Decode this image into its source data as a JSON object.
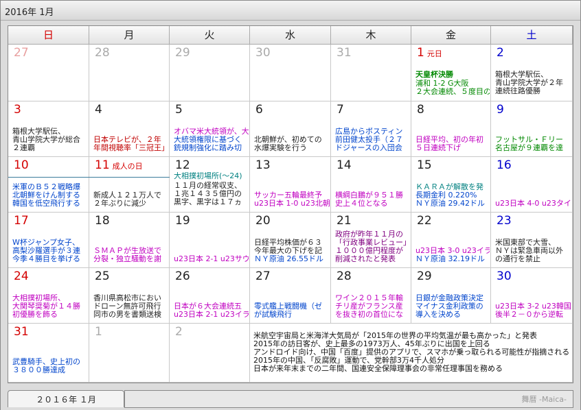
{
  "window": {
    "title": "2016年 1月"
  },
  "weekdays": [
    "日",
    "月",
    "火",
    "水",
    "木",
    "金",
    "土"
  ],
  "days": [
    {
      "n": "27",
      "style": "pinkgrey",
      "events": []
    },
    {
      "n": "28",
      "style": "grey",
      "events": []
    },
    {
      "n": "29",
      "style": "grey",
      "events": []
    },
    {
      "n": "30",
      "style": "grey",
      "events": []
    },
    {
      "n": "31",
      "style": "grey",
      "events": []
    },
    {
      "n": "1",
      "style": "sun",
      "holiday": "元日",
      "events": [
        {
          "t": "天皇杯決勝",
          "c": "c-green bold",
          "y": 38
        },
        {
          "t": "浦和 1-2 G大阪",
          "c": "c-green",
          "y": 51
        },
        {
          "t": "２大会連続、５度目の",
          "c": "c-green",
          "y": 63
        }
      ]
    },
    {
      "n": "2",
      "style": "sat",
      "events": [
        {
          "t": "箱根大学駅伝、",
          "c": "c-black",
          "y": 38
        },
        {
          "t": "青山学院大学が２年",
          "c": "c-black",
          "y": 50
        },
        {
          "t": "連続往路優勝",
          "c": "c-black",
          "y": 62
        }
      ]
    },
    {
      "n": "3",
      "style": "sun",
      "events": [
        {
          "t": "箱根大学駅伝、",
          "c": "c-black",
          "y": 38
        },
        {
          "t": "青山学院大学が総合",
          "c": "c-black",
          "y": 50
        },
        {
          "t": "２連覇",
          "c": "c-black",
          "y": 62
        }
      ]
    },
    {
      "n": "4",
      "style": "c-black",
      "events": [
        {
          "t": "日本テレビが、２年",
          "c": "c-red",
          "y": 50
        },
        {
          "t": "年間視聴率「三冠王」",
          "c": "c-red",
          "y": 62
        }
      ]
    },
    {
      "n": "5",
      "style": "c-black",
      "events": [
        {
          "t": "オバマ米大統領が、大",
          "c": "c-mag",
          "y": 38
        },
        {
          "t": "大統領権限に基づく",
          "c": "c-blue",
          "y": 50
        },
        {
          "t": "銃規制強化に踏み切",
          "c": "c-blue",
          "y": 62
        }
      ]
    },
    {
      "n": "6",
      "style": "c-black",
      "events": [
        {
          "t": "北朝鮮が、初めての",
          "c": "c-black",
          "y": 50
        },
        {
          "t": "水爆実験を行う",
          "c": "c-black",
          "y": 62
        }
      ]
    },
    {
      "n": "7",
      "style": "c-black",
      "events": [
        {
          "t": "広島からポスティン",
          "c": "c-blue",
          "y": 38
        },
        {
          "t": "前田健太投手（２７",
          "c": "c-blue",
          "y": 50
        },
        {
          "t": "ドジャースの入団会",
          "c": "c-blue",
          "y": 62
        }
      ]
    },
    {
      "n": "8",
      "style": "c-black",
      "events": [
        {
          "t": "日経平均、初の年初",
          "c": "c-mag",
          "y": 50
        },
        {
          "t": "５日連続下げ",
          "c": "c-mag",
          "y": 62
        }
      ]
    },
    {
      "n": "9",
      "style": "sat",
      "events": [
        {
          "t": "フットサル・Ｆリー",
          "c": "c-green",
          "y": 50
        },
        {
          "t": "名古屋が９連覇を達",
          "c": "c-green",
          "y": 62
        }
      ]
    },
    {
      "n": "10",
      "style": "sun",
      "events": [
        {
          "t": "米軍のＢ５２戦略爆",
          "c": "c-blue",
          "y": 38
        },
        {
          "t": "北朝鮮をけん制する",
          "c": "c-blue",
          "y": 50
        },
        {
          "t": "韓国を低空飛行する",
          "c": "c-blue",
          "y": 62
        }
      ]
    },
    {
      "n": "11",
      "style": "sun",
      "holiday": "成人の日",
      "events": [
        {
          "t": "新成人１２１万人で",
          "c": "c-black",
          "y": 50
        },
        {
          "t": "２年ぶりに減少",
          "c": "c-black",
          "y": 62
        }
      ]
    },
    {
      "n": "12",
      "style": "c-black",
      "events": [
        {
          "t": "大相撲初場所(～24)",
          "c": "c-teal",
          "y": 22
        },
        {
          "t": "１１月の経常収支、",
          "c": "c-black",
          "y": 36
        },
        {
          "t": "１兆１４３５億円の",
          "c": "c-black",
          "y": 48
        },
        {
          "t": "黒字、黒字は１７ヵ",
          "c": "c-black",
          "y": 60
        }
      ]
    },
    {
      "n": "13",
      "style": "c-black",
      "events": [
        {
          "t": "サッカー五輪最終予",
          "c": "c-mag",
          "y": 50
        },
        {
          "t": "u23日本 1-0 u23北朝",
          "c": "c-mag",
          "y": 62
        }
      ]
    },
    {
      "n": "14",
      "style": "c-black",
      "events": [
        {
          "t": "横綱白鵬が９５１勝",
          "c": "c-mag",
          "y": 50
        },
        {
          "t": "史上４位となる",
          "c": "c-mag",
          "y": 62
        }
      ]
    },
    {
      "n": "15",
      "style": "c-black",
      "events": [
        {
          "t": "ＫＡＲＡが解散を発",
          "c": "c-teal",
          "y": 38
        },
        {
          "t": "長期金利 0.220%",
          "c": "c-blue",
          "y": 50
        },
        {
          "t": "ＮＹ原油 29.42ドル",
          "c": "c-blue",
          "y": 62
        }
      ]
    },
    {
      "n": "16",
      "style": "sat",
      "events": [
        {
          "t": "u23日本 4-0 u23タイ",
          "c": "c-mag",
          "y": 62
        }
      ]
    },
    {
      "n": "17",
      "style": "sun",
      "events": [
        {
          "t": "W杯ジャンプ女子、",
          "c": "c-blue",
          "y": 38
        },
        {
          "t": "高梨沙羅選手が３連",
          "c": "c-blue",
          "y": 50
        },
        {
          "t": "今季４勝目を挙げる",
          "c": "c-blue",
          "y": 62
        }
      ]
    },
    {
      "n": "18",
      "style": "c-black",
      "events": [
        {
          "t": "ＳＭＡＰが生放送で",
          "c": "c-mag",
          "y": 50
        },
        {
          "t": "分裂・独立騒動を謝",
          "c": "c-mag",
          "y": 62
        }
      ]
    },
    {
      "n": "19",
      "style": "c-black",
      "events": [
        {
          "t": "u23日本 2-1 u23サウ",
          "c": "c-mag",
          "y": 62
        }
      ]
    },
    {
      "n": "20",
      "style": "c-black",
      "events": [
        {
          "t": "日経平均株価が６３",
          "c": "c-black",
          "y": 38
        },
        {
          "t": "今年最大の下げを記",
          "c": "c-black",
          "y": 50
        },
        {
          "t": "ＮＹ原油 26.55ドル",
          "c": "c-blue",
          "y": 62
        }
      ]
    },
    {
      "n": "21",
      "style": "c-black",
      "events": [
        {
          "t": "政府が昨年１１月の",
          "c": "c-purple",
          "y": 26
        },
        {
          "t": "「行政事業レビュー」",
          "c": "c-purple",
          "y": 38
        },
        {
          "t": "１０００億円程度が",
          "c": "c-purple",
          "y": 50
        },
        {
          "t": "削減されたと発表",
          "c": "c-purple",
          "y": 62
        }
      ]
    },
    {
      "n": "22",
      "style": "c-black",
      "events": [
        {
          "t": "u23日本 3-0 u23イラ",
          "c": "c-mag",
          "y": 50
        },
        {
          "t": "ＮＹ原油 32.19ドル",
          "c": "c-blue",
          "y": 62
        }
      ]
    },
    {
      "n": "23",
      "style": "sat",
      "events": [
        {
          "t": "米国東部で大雪、",
          "c": "c-black",
          "y": 38
        },
        {
          "t": "ＮＹは緊急車両以外",
          "c": "c-black",
          "y": 50
        },
        {
          "t": "の通行を禁止",
          "c": "c-black",
          "y": 62
        }
      ]
    },
    {
      "n": "24",
      "style": "sun",
      "events": [
        {
          "t": "大相撲初場所、",
          "c": "c-mag",
          "y": 38
        },
        {
          "t": "大関琴奨菊が１４勝",
          "c": "c-mag",
          "y": 50
        },
        {
          "t": "初優勝を飾る",
          "c": "c-mag",
          "y": 62
        }
      ]
    },
    {
      "n": "25",
      "style": "c-black",
      "events": [
        {
          "t": "香川県高松市におい",
          "c": "c-black",
          "y": 38
        },
        {
          "t": "ドローン無許可飛行",
          "c": "c-black",
          "y": 50
        },
        {
          "t": "同市の男を書類送検",
          "c": "c-black",
          "y": 62
        }
      ]
    },
    {
      "n": "26",
      "style": "c-black",
      "events": [
        {
          "t": "日本が６大会連続五",
          "c": "c-mag",
          "y": 50
        },
        {
          "t": "u23日本 2-1 u23イラ",
          "c": "c-mag",
          "y": 62
        }
      ]
    },
    {
      "n": "27",
      "style": "c-black",
      "events": [
        {
          "t": "零式艦上戦闘機（ゼ",
          "c": "c-blue",
          "y": 50
        },
        {
          "t": "が試験飛行",
          "c": "c-blue",
          "y": 62
        }
      ]
    },
    {
      "n": "28",
      "style": "c-black",
      "events": [
        {
          "t": "ワイン２０１５年輸",
          "c": "c-mag",
          "y": 38
        },
        {
          "t": "チリ産がフランス産",
          "c": "c-mag",
          "y": 50
        },
        {
          "t": "を抜き初の首位にな",
          "c": "c-mag",
          "y": 62
        }
      ]
    },
    {
      "n": "29",
      "style": "c-black",
      "events": [
        {
          "t": "日銀が金融政策決定",
          "c": "c-blue",
          "y": 38
        },
        {
          "t": "マイナス金利政策の",
          "c": "c-blue",
          "y": 50
        },
        {
          "t": "導入を決める",
          "c": "c-blue",
          "y": 62
        }
      ]
    },
    {
      "n": "30",
      "style": "sat",
      "events": [
        {
          "t": "u23日本 3-2 u23韓国",
          "c": "c-mag",
          "y": 50
        },
        {
          "t": "後半２－０から逆転",
          "c": "c-mag",
          "y": 62
        }
      ]
    },
    {
      "n": "31",
      "style": "sun",
      "events": [
        {
          "t": "武豊騎手、史上初の",
          "c": "c-blue",
          "y": 50
        },
        {
          "t": "３８００勝達成",
          "c": "c-blue",
          "y": 62
        }
      ]
    },
    {
      "n": "1",
      "style": "grey",
      "events": []
    },
    {
      "n": "2",
      "style": "grey",
      "events": []
    }
  ],
  "news": [
    "米航空宇宙局と米海洋大気局が「2015年の世界の平均気温が最も高かった」と発表",
    "2015年の訪日客が、史上最多の1973万人、45年ぶりに出国を上回る",
    "アンドロイド向け、中国「百度」提供のアプリで、スマホが乗っ取られる可能性が指摘される",
    "2015年の中国、「反腐敗」運動で、党幹部3万4千人処分",
    "日本が来年末までの二年間、国連安全保障理事会の非常任理事国を務める"
  ],
  "tab": {
    "label": "２０１６年 １月"
  },
  "brand": "舞暦 -Maica-"
}
